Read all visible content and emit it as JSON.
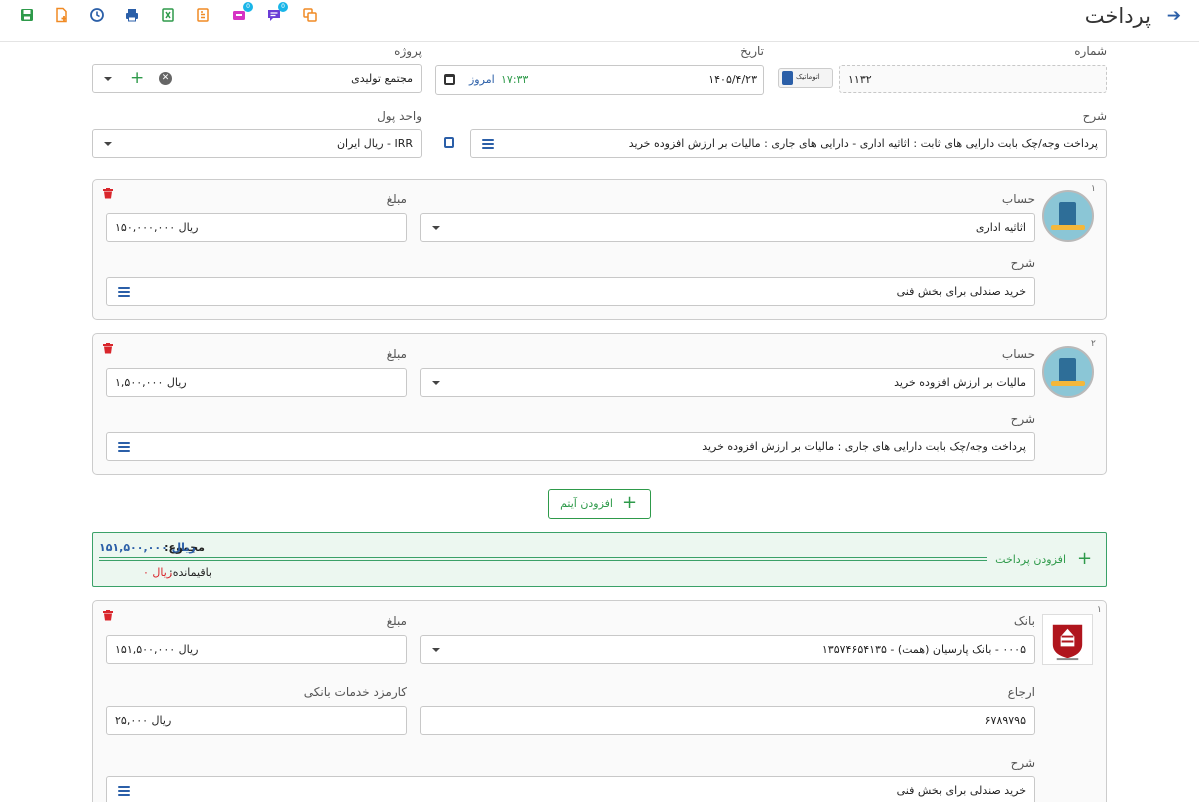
{
  "header": {
    "title": "پرداخت",
    "back_icon": "arrow-right-icon",
    "toolbar": [
      {
        "name": "save-icon",
        "color": "#2e9a4a",
        "badge": ""
      },
      {
        "name": "new-document-icon",
        "color": "#f08a24",
        "badge": ""
      },
      {
        "name": "history-icon",
        "color": "#2b5fa8",
        "badge": ""
      },
      {
        "name": "print-icon",
        "color": "#2b5fa8",
        "badge": ""
      },
      {
        "name": "excel-icon",
        "color": "#2e9a4a",
        "badge": ""
      },
      {
        "name": "report-icon",
        "color": "#f08a24",
        "badge": ""
      },
      {
        "name": "inbox-icon",
        "color": "#d633c4",
        "badge": "0"
      },
      {
        "name": "comments-icon",
        "color": "#6a3dd6",
        "badge": "0"
      },
      {
        "name": "copy-icon",
        "color": "#f08a24",
        "badge": ""
      }
    ]
  },
  "form": {
    "number": {
      "label": "شماره",
      "value": "۱۱۳۲",
      "auto_label": "اتوماتیک"
    },
    "date": {
      "label": "تاریخ",
      "value": "۱۴۰۵/۴/۲۳",
      "time": "۱۷:۳۳",
      "today_label": "امروز"
    },
    "project": {
      "label": "پروژه",
      "value": "مجتمع تولیدی"
    },
    "description": {
      "label": "شرح",
      "value": "پرداخت وجه/چک بابت دارایی های ثابت : اثاثیه اداری - دارایی های جاری : مالیات بر ارزش افزوده خرید"
    },
    "currency": {
      "label": "واحد پول",
      "value": "IRR - ریال ایران"
    }
  },
  "items": [
    {
      "index": "۱",
      "account_label": "حساب",
      "account": "اثاثیه اداری",
      "amount_label": "مبلغ",
      "amount": "ریال ۱۵۰,۰۰۰,۰۰۰",
      "desc_label": "شرح",
      "desc": "خرید صندلی برای بخش فنی"
    },
    {
      "index": "۲",
      "account_label": "حساب",
      "account": "مالیات بر ارزش افزوده خرید",
      "amount_label": "مبلغ",
      "amount": "ریال ۱,۵۰۰,۰۰۰",
      "desc_label": "شرح",
      "desc": "پرداخت وجه/چک بابت دارایی های جاری : مالیات بر ارزش افزوده خرید"
    }
  ],
  "add_item_label": "افزودن آیتم",
  "summary": {
    "add_payment_label": "افزودن پرداخت",
    "total_label": "مجموع:",
    "total_value": "ریال ۱۵۱,۵۰۰,۰۰۰",
    "remaining_label": "باقیمانده:",
    "remaining_value": "ریال ۰"
  },
  "payment": {
    "index": "۱",
    "bank_label": "بانک",
    "bank": "۰۰۰۵ - بانک پارسیان (همت) - ۱۳۵۷۴۶۵۴۱۳۵",
    "amount_label": "مبلغ",
    "amount": "ریال ۱۵۱,۵۰۰,۰۰۰",
    "ref_label": "ارجاع",
    "ref": "۶۷۸۹۷۹۵",
    "fee_label": "کارمزد خدمات بانکی",
    "fee": "ریال ۲۵,۰۰۰",
    "desc_label": "شرح",
    "desc": "خرید صندلی برای بخش فنی"
  }
}
